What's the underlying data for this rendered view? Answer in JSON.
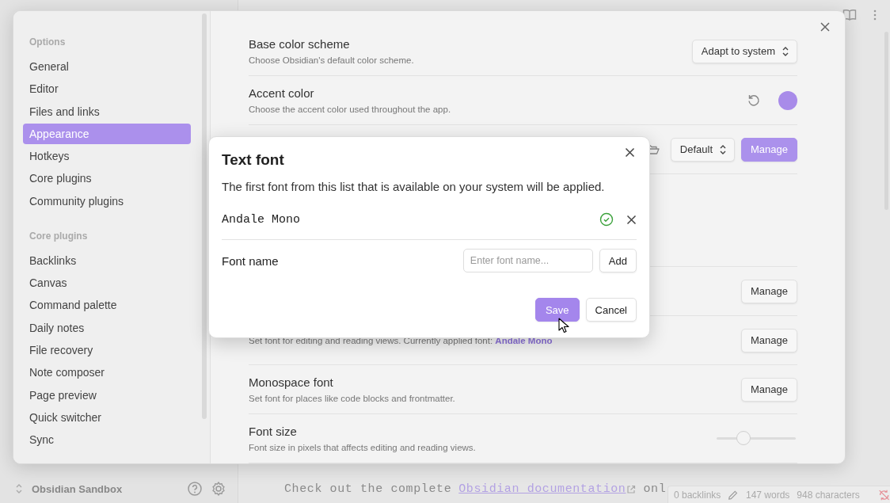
{
  "app": {
    "vault_name": "Obsidian Sandbox",
    "editor": {
      "line_start": "Check out the complete",
      "link": "Obsidian documentation",
      "line_end": "onl"
    },
    "status_bar": {
      "backlinks": "0 backlinks",
      "words": "147 words",
      "characters": "948 characters"
    }
  },
  "settings": {
    "sidebar": [
      {
        "heading": "Options",
        "items": [
          {
            "label": "General",
            "selected": false
          },
          {
            "label": "Editor",
            "selected": false
          },
          {
            "label": "Files and links",
            "selected": false
          },
          {
            "label": "Appearance",
            "selected": true
          },
          {
            "label": "Hotkeys",
            "selected": false
          },
          {
            "label": "Core plugins",
            "selected": false
          },
          {
            "label": "Community plugins",
            "selected": false
          }
        ]
      },
      {
        "heading": "Core plugins",
        "items": [
          {
            "label": "Backlinks",
            "selected": false
          },
          {
            "label": "Canvas",
            "selected": false
          },
          {
            "label": "Command palette",
            "selected": false
          },
          {
            "label": "Daily notes",
            "selected": false
          },
          {
            "label": "File recovery",
            "selected": false
          },
          {
            "label": "Note composer",
            "selected": false
          },
          {
            "label": "Page preview",
            "selected": false
          },
          {
            "label": "Quick switcher",
            "selected": false
          },
          {
            "label": "Sync",
            "selected": false
          }
        ]
      }
    ],
    "rows": [
      {
        "kind": "select",
        "title": "Base color scheme",
        "description": "Choose Obsidian's default color scheme.",
        "value": "Adapt to system"
      },
      {
        "kind": "color",
        "title": "Accent color",
        "description": "Choose the accent color used throughout the app.",
        "color": "#a88be9"
      },
      {
        "kind": "font-file",
        "value": "Default",
        "button": "Manage"
      },
      {
        "kind": "blank"
      },
      {
        "kind": "manage",
        "button": "Manage"
      },
      {
        "kind": "manage",
        "description": "Set font for editing and reading views. Currently applied font: **Andale Mono**",
        "button": "Manage"
      },
      {
        "kind": "manage",
        "title": "Monospace font",
        "description": "Set font for places like code blocks and frontmatter.",
        "button": "Manage"
      },
      {
        "kind": "slider",
        "title": "Font size",
        "description": "Font size in pixels that affects editing and reading views.",
        "level": 0.34
      }
    ]
  },
  "dialog": {
    "title": "Text font",
    "description": "The first font from this list that is available on your system will be applied.",
    "fonts": [
      {
        "name": "Andale Mono",
        "available": true
      }
    ],
    "field_label": "Font name",
    "placeholder": "Enter font name...",
    "add": "Add",
    "save": "Save",
    "cancel": "Cancel"
  }
}
